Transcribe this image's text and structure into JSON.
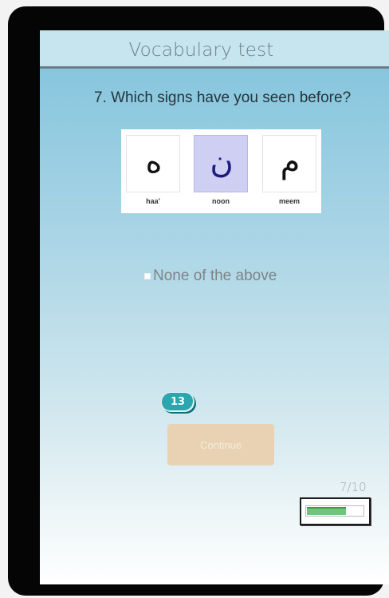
{
  "header": {
    "title": "Vocabulary test"
  },
  "question": {
    "text": "7. Which signs have you seen before?"
  },
  "cards": [
    {
      "glyph": "ه",
      "label": "haa'",
      "selected": false
    },
    {
      "glyph": "ن",
      "label": "noon",
      "selected": true
    },
    {
      "glyph": "م",
      "label": "meem",
      "selected": false
    }
  ],
  "none_option": {
    "label": "None of the above",
    "checked": false
  },
  "counter": {
    "value": "13"
  },
  "continue_button": {
    "label": "Continue"
  },
  "progress": {
    "text": "7/10",
    "fraction": 0.7
  },
  "colors": {
    "accent": "#2aa6ae",
    "continue_button": "#e8d2b3",
    "progress_fill": "#72c47a",
    "selected_card": "#cfcff4"
  }
}
